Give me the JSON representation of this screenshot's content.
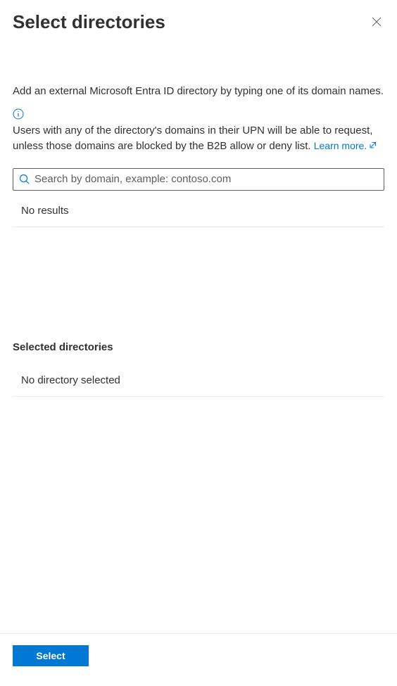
{
  "header": {
    "title": "Select directories"
  },
  "description": "Add an external Microsoft Entra ID directory by typing one of its domain names.",
  "info": {
    "text": "Users with any of the directory's domains in their UPN will be able to request, unless those domains are blocked by the B2B allow or deny list. ",
    "learn_more_label": "Learn more."
  },
  "search": {
    "placeholder": "Search by domain, example: contoso.com",
    "value": ""
  },
  "results": {
    "no_results_label": "No results"
  },
  "selected": {
    "heading": "Selected directories",
    "no_selection_label": "No directory selected"
  },
  "footer": {
    "select_label": "Select"
  }
}
